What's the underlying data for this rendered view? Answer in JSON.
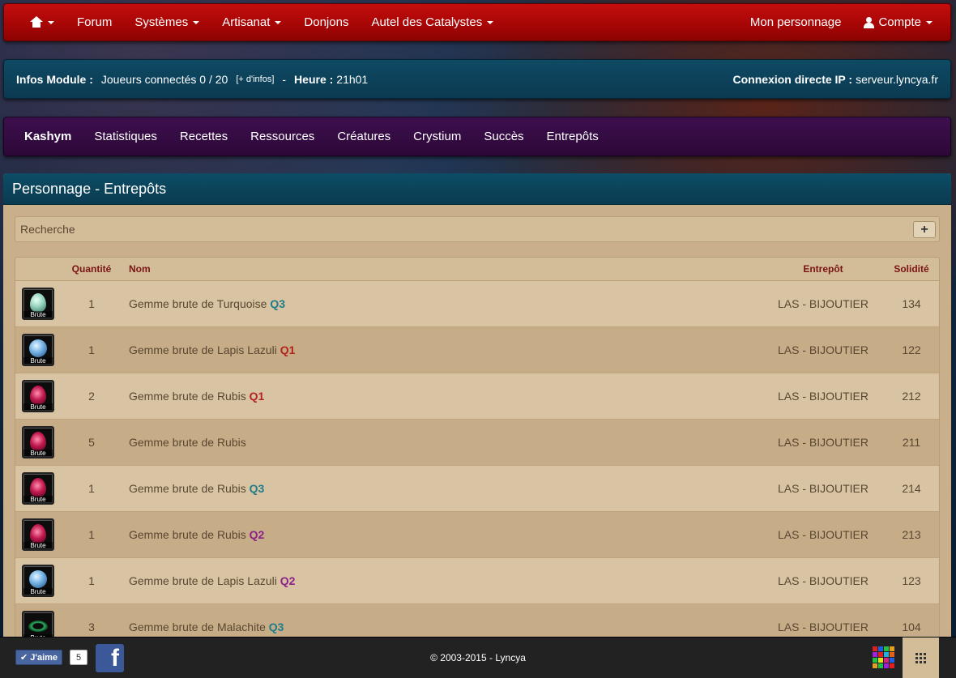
{
  "topnav": {
    "items": [
      {
        "label": "Forum"
      },
      {
        "label": "Systèmes"
      },
      {
        "label": "Artisanat"
      },
      {
        "label": "Donjons"
      },
      {
        "label": "Autel des Catalystes"
      }
    ],
    "right": {
      "character": "Mon personnage",
      "account": "Compte"
    }
  },
  "infobar": {
    "module_label": "Infos Module :",
    "players": "Joueurs connectés 0 / 20",
    "more_info": "[+ d'infos]",
    "separator": "-",
    "time_label": "Heure :",
    "time_value": "21h01",
    "ip_label": "Connexion directe IP :",
    "ip_value": "serveur.lyncya.fr"
  },
  "charnav": {
    "items": [
      {
        "label": "Kashym"
      },
      {
        "label": "Statistiques"
      },
      {
        "label": "Recettes"
      },
      {
        "label": "Ressources"
      },
      {
        "label": "Créatures"
      },
      {
        "label": "Crystium"
      },
      {
        "label": "Succès"
      },
      {
        "label": "Entrepôts"
      }
    ]
  },
  "panel": {
    "title": "Personnage - Entrepôts",
    "search_label": "Recherche",
    "plus": "+"
  },
  "table": {
    "headers": {
      "qty": "Quantité",
      "name": "Nom",
      "warehouse": "Entrepôt",
      "solidity": "Solidité"
    },
    "icon_label": "Brute",
    "rows": [
      {
        "qty": "1",
        "name": "Gemme brute de Turquoise",
        "quality": "Q3",
        "warehouse": "LAS - BIJOUTIER",
        "solidity": "134"
      },
      {
        "qty": "1",
        "name": "Gemme brute de Lapis Lazuli",
        "quality": "Q1",
        "warehouse": "LAS - BIJOUTIER",
        "solidity": "122"
      },
      {
        "qty": "2",
        "name": "Gemme brute de Rubis",
        "quality": "Q1",
        "warehouse": "LAS - BIJOUTIER",
        "solidity": "212"
      },
      {
        "qty": "5",
        "name": "Gemme brute de Rubis",
        "quality": "",
        "warehouse": "LAS - BIJOUTIER",
        "solidity": "211"
      },
      {
        "qty": "1",
        "name": "Gemme brute de Rubis",
        "quality": "Q3",
        "warehouse": "LAS - BIJOUTIER",
        "solidity": "214"
      },
      {
        "qty": "1",
        "name": "Gemme brute de Rubis",
        "quality": "Q2",
        "warehouse": "LAS - BIJOUTIER",
        "solidity": "213"
      },
      {
        "qty": "1",
        "name": "Gemme brute de Lapis Lazuli",
        "quality": "Q2",
        "warehouse": "LAS - BIJOUTIER",
        "solidity": "123"
      },
      {
        "qty": "3",
        "name": "Gemme brute de Malachite",
        "quality": "Q3",
        "warehouse": "LAS - BIJOUTIER",
        "solidity": "104"
      }
    ]
  },
  "footer": {
    "like_label": "J'aime",
    "like_count": "5",
    "fb_letter": "f",
    "copyright": "© 2003-2015 - Lyncya"
  },
  "colors": {
    "topnav_red": "#b00808",
    "infobar_teal": "#0d4560",
    "charnav_purple": "#360c45",
    "q1": "#b22222",
    "q2": "#8b1f8b",
    "q3": "#1f7b8a"
  }
}
